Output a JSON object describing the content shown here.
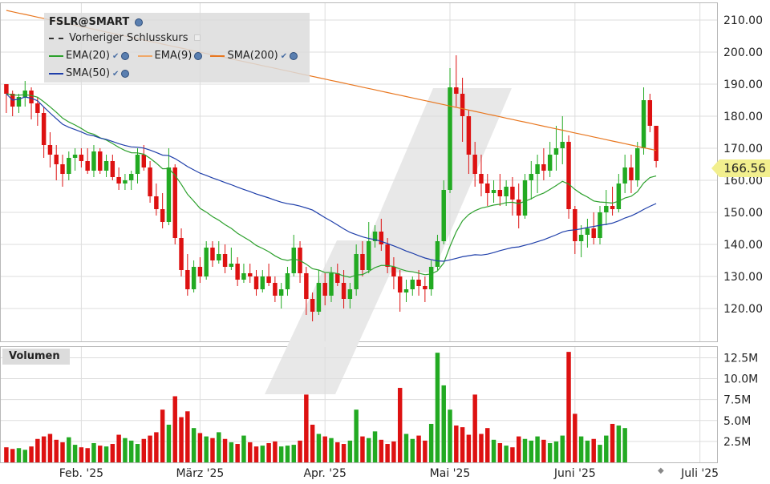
{
  "header": {
    "symbol": "FSLR@SMART",
    "prev_close_label": "Vorheriger Schlusskurs",
    "last_price": "166.56"
  },
  "legend": [
    {
      "name": "EMA(20)",
      "color": "#2ca02c"
    },
    {
      "name": "EMA(9)",
      "color": "#f0a868"
    },
    {
      "name": "SMA(200)",
      "color": "#e8761e"
    },
    {
      "name": "SMA(50)",
      "color": "#1f3faa"
    }
  ],
  "volume_panel": {
    "title": "Volumen"
  },
  "chart_data": {
    "type": "candlestick",
    "price_axis": {
      "ticks": [
        120,
        130,
        140,
        150,
        160,
        170,
        180,
        190,
        200,
        210
      ],
      "tick_labels": [
        "120.00",
        "130.00",
        "140.00",
        "150.00",
        "160.00",
        "170.00",
        "180.00",
        "190.00",
        "200.00",
        "210.00"
      ],
      "range": [
        110,
        215
      ]
    },
    "volume_axis": {
      "ticks": [
        2.5,
        5,
        7.5,
        10,
        12.5
      ],
      "tick_labels": [
        "2.5M",
        "5.0M",
        "7.5M",
        "10.0M",
        "12.5M"
      ],
      "range": [
        0,
        13.5
      ]
    },
    "x_axis": {
      "labels": [
        "Feb. '25",
        "März '25",
        "Apr. '25",
        "Mai '25",
        "Juni '25",
        "Juli '25"
      ],
      "label_at_bar": [
        12,
        31,
        51,
        71,
        91,
        111
      ]
    },
    "colors": {
      "up": "#22aa22",
      "down": "#dd1111",
      "grid": "#dddddd",
      "watermark": "#e6e6e6"
    },
    "candles": [
      [
        190,
        190,
        181,
        187
      ],
      [
        187,
        188,
        180,
        183
      ],
      [
        183,
        187,
        181,
        186
      ],
      [
        186,
        191,
        183,
        188
      ],
      [
        188,
        189,
        179,
        184
      ],
      [
        184,
        186,
        177,
        181
      ],
      [
        181,
        183,
        167,
        171
      ],
      [
        171,
        175,
        164,
        168
      ],
      [
        168,
        171,
        160,
        165
      ],
      [
        165,
        168,
        158,
        162
      ],
      [
        162,
        169,
        160,
        167
      ],
      [
        167,
        170,
        163,
        168
      ],
      [
        168,
        170,
        164,
        166
      ],
      [
        166,
        170,
        162,
        163
      ],
      [
        163,
        171,
        161,
        169
      ],
      [
        169,
        170,
        162,
        163
      ],
      [
        163,
        168,
        161,
        166
      ],
      [
        166,
        168,
        160,
        161
      ],
      [
        161,
        164,
        157,
        159
      ],
      [
        159,
        162,
        157,
        160
      ],
      [
        160,
        163,
        157,
        162
      ],
      [
        162,
        170,
        159,
        168
      ],
      [
        168,
        171,
        163,
        164
      ],
      [
        164,
        166,
        153,
        155
      ],
      [
        155,
        159,
        149,
        151
      ],
      [
        151,
        156,
        145,
        147
      ],
      [
        147,
        170,
        146,
        164
      ],
      [
        164,
        165,
        140,
        142
      ],
      [
        142,
        145,
        130,
        132
      ],
      [
        132,
        137,
        124,
        126
      ],
      [
        126,
        135,
        125,
        133
      ],
      [
        133,
        136,
        128,
        130
      ],
      [
        130,
        141,
        129,
        139
      ],
      [
        139,
        141,
        133,
        135
      ],
      [
        135,
        141,
        134,
        137
      ],
      [
        137,
        140,
        131,
        133
      ],
      [
        133,
        139,
        132,
        134
      ],
      [
        134,
        136,
        127,
        129
      ],
      [
        129,
        134,
        128,
        131
      ],
      [
        131,
        134,
        128,
        130
      ],
      [
        130,
        132,
        124,
        126
      ],
      [
        126,
        132,
        125,
        130
      ],
      [
        130,
        134,
        127,
        128
      ],
      [
        128,
        130,
        122,
        124
      ],
      [
        124,
        128,
        120,
        126
      ],
      [
        126,
        133,
        124,
        131
      ],
      [
        131,
        143,
        130,
        139
      ],
      [
        139,
        141,
        128,
        131
      ],
      [
        131,
        133,
        118,
        123
      ],
      [
        123,
        125,
        116,
        119
      ],
      [
        119,
        132,
        118,
        128
      ],
      [
        128,
        131,
        121,
        124
      ],
      [
        124,
        133,
        122,
        131
      ],
      [
        131,
        134,
        127,
        128
      ],
      [
        128,
        132,
        120,
        123
      ],
      [
        123,
        128,
        120,
        126
      ],
      [
        126,
        140,
        124,
        137
      ],
      [
        137,
        141,
        130,
        132
      ],
      [
        132,
        147,
        131,
        141
      ],
      [
        141,
        146,
        139,
        144
      ],
      [
        144,
        148,
        138,
        140
      ],
      [
        140,
        142,
        131,
        133
      ],
      [
        133,
        136,
        126,
        130
      ],
      [
        130,
        132,
        119,
        125
      ],
      [
        125,
        129,
        122,
        126
      ],
      [
        126,
        130,
        124,
        129
      ],
      [
        129,
        132,
        124,
        127
      ],
      [
        127,
        130,
        122,
        126
      ],
      [
        126,
        135,
        124,
        133
      ],
      [
        133,
        143,
        132,
        141
      ],
      [
        141,
        160,
        140,
        157
      ],
      [
        157,
        195,
        156,
        189
      ],
      [
        189,
        199,
        183,
        187
      ],
      [
        187,
        192,
        172,
        180
      ],
      [
        180,
        182,
        162,
        168
      ],
      [
        168,
        172,
        158,
        162
      ],
      [
        162,
        168,
        155,
        159
      ],
      [
        159,
        162,
        152,
        156
      ],
      [
        156,
        160,
        153,
        157
      ],
      [
        157,
        162,
        152,
        155
      ],
      [
        155,
        160,
        152,
        158
      ],
      [
        158,
        161,
        149,
        154
      ],
      [
        154,
        159,
        145,
        149
      ],
      [
        149,
        162,
        148,
        160
      ],
      [
        160,
        166,
        154,
        162
      ],
      [
        162,
        168,
        156,
        165
      ],
      [
        165,
        170,
        160,
        163
      ],
      [
        163,
        172,
        161,
        168
      ],
      [
        168,
        177,
        163,
        170
      ],
      [
        170,
        180,
        165,
        172
      ],
      [
        172,
        174,
        148,
        151
      ],
      [
        151,
        152,
        137,
        141
      ],
      [
        141,
        146,
        136,
        143
      ],
      [
        143,
        148,
        139,
        145
      ],
      [
        145,
        150,
        140,
        142
      ],
      [
        142,
        152,
        140,
        150
      ],
      [
        150,
        157,
        146,
        152
      ],
      [
        152,
        158,
        149,
        151
      ],
      [
        151,
        162,
        150,
        159
      ],
      [
        159,
        168,
        156,
        164
      ],
      [
        164,
        168,
        156,
        160
      ],
      [
        160,
        172,
        158,
        170
      ],
      [
        170,
        189,
        168,
        185
      ],
      [
        185,
        187,
        175,
        177
      ],
      [
        177,
        172,
        164,
        166
      ]
    ],
    "volumes": [
      1.8,
      1.6,
      1.7,
      1.5,
      1.9,
      2.8,
      3.1,
      3.4,
      2.7,
      2.4,
      3.0,
      2.1,
      1.8,
      1.7,
      2.3,
      2.0,
      1.9,
      2.2,
      3.3,
      2.9,
      2.6,
      2.2,
      2.8,
      3.2,
      3.6,
      6.3,
      4.5,
      7.9,
      5.4,
      6.1,
      4.1,
      3.5,
      3.1,
      2.9,
      3.6,
      2.8,
      2.4,
      2.2,
      3.2,
      2.4,
      1.9,
      2.0,
      2.3,
      2.5,
      1.9,
      2.0,
      2.1,
      2.6,
      8.1,
      4.5,
      3.4,
      3.1,
      2.9,
      2.4,
      2.2,
      2.6,
      6.3,
      3.1,
      2.9,
      3.7,
      2.7,
      2.2,
      2.5,
      8.9,
      3.4,
      2.8,
      3.2,
      2.6,
      4.6,
      13.1,
      9.2,
      6.3,
      4.4,
      4.2,
      3.3,
      8.1,
      3.4,
      4.1,
      2.7,
      2.3,
      2.0,
      1.8,
      3.1,
      2.8,
      2.6,
      3.1,
      2.7,
      2.3,
      2.5,
      3.2,
      13.2,
      5.8,
      3.1,
      2.6,
      2.8,
      2.1,
      3.2,
      4.6,
      4.4,
      4.1
    ]
  }
}
